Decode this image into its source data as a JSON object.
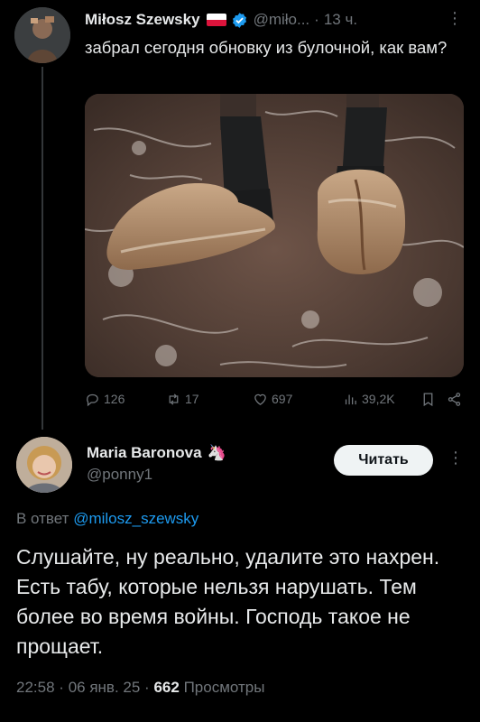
{
  "tweet": {
    "author_name": "Miłosz Szewsky",
    "handle": "@miło...",
    "separator": "·",
    "time": "13 ч.",
    "more": "⋮",
    "text": "забрал сегодня обновку из булочной, как вам?",
    "icons": [
      "polish-flag",
      "verified-badge",
      "reply",
      "retweet",
      "like",
      "views",
      "bookmark",
      "share"
    ],
    "stats": {
      "replies": "126",
      "retweets": "17",
      "likes": "697",
      "views": "39,2K"
    }
  },
  "reply": {
    "author_name": "Maria Baronova",
    "author_emoji": "🦄",
    "handle": "@ponny1",
    "follow_label": "Читать",
    "more": "⋮",
    "reply_prefix": "В ответ",
    "reply_mention": "@milosz_szewsky",
    "text": "Слушайте, ну реально, удалите это нахрен. Есть табу, которые нельзя нарушать. Тем более во время войны. Господь такое не прощает.",
    "time": "22:58",
    "date": "06 янв. 25",
    "separator": "·",
    "views_count": "662",
    "views_label": "Просмотры"
  },
  "colors": {
    "background": "#000000",
    "text": "#e7e9ea",
    "muted": "#71767b",
    "link": "#1d9bf0",
    "verified": "#1d9bf0",
    "button_bg": "#eff3f4"
  }
}
